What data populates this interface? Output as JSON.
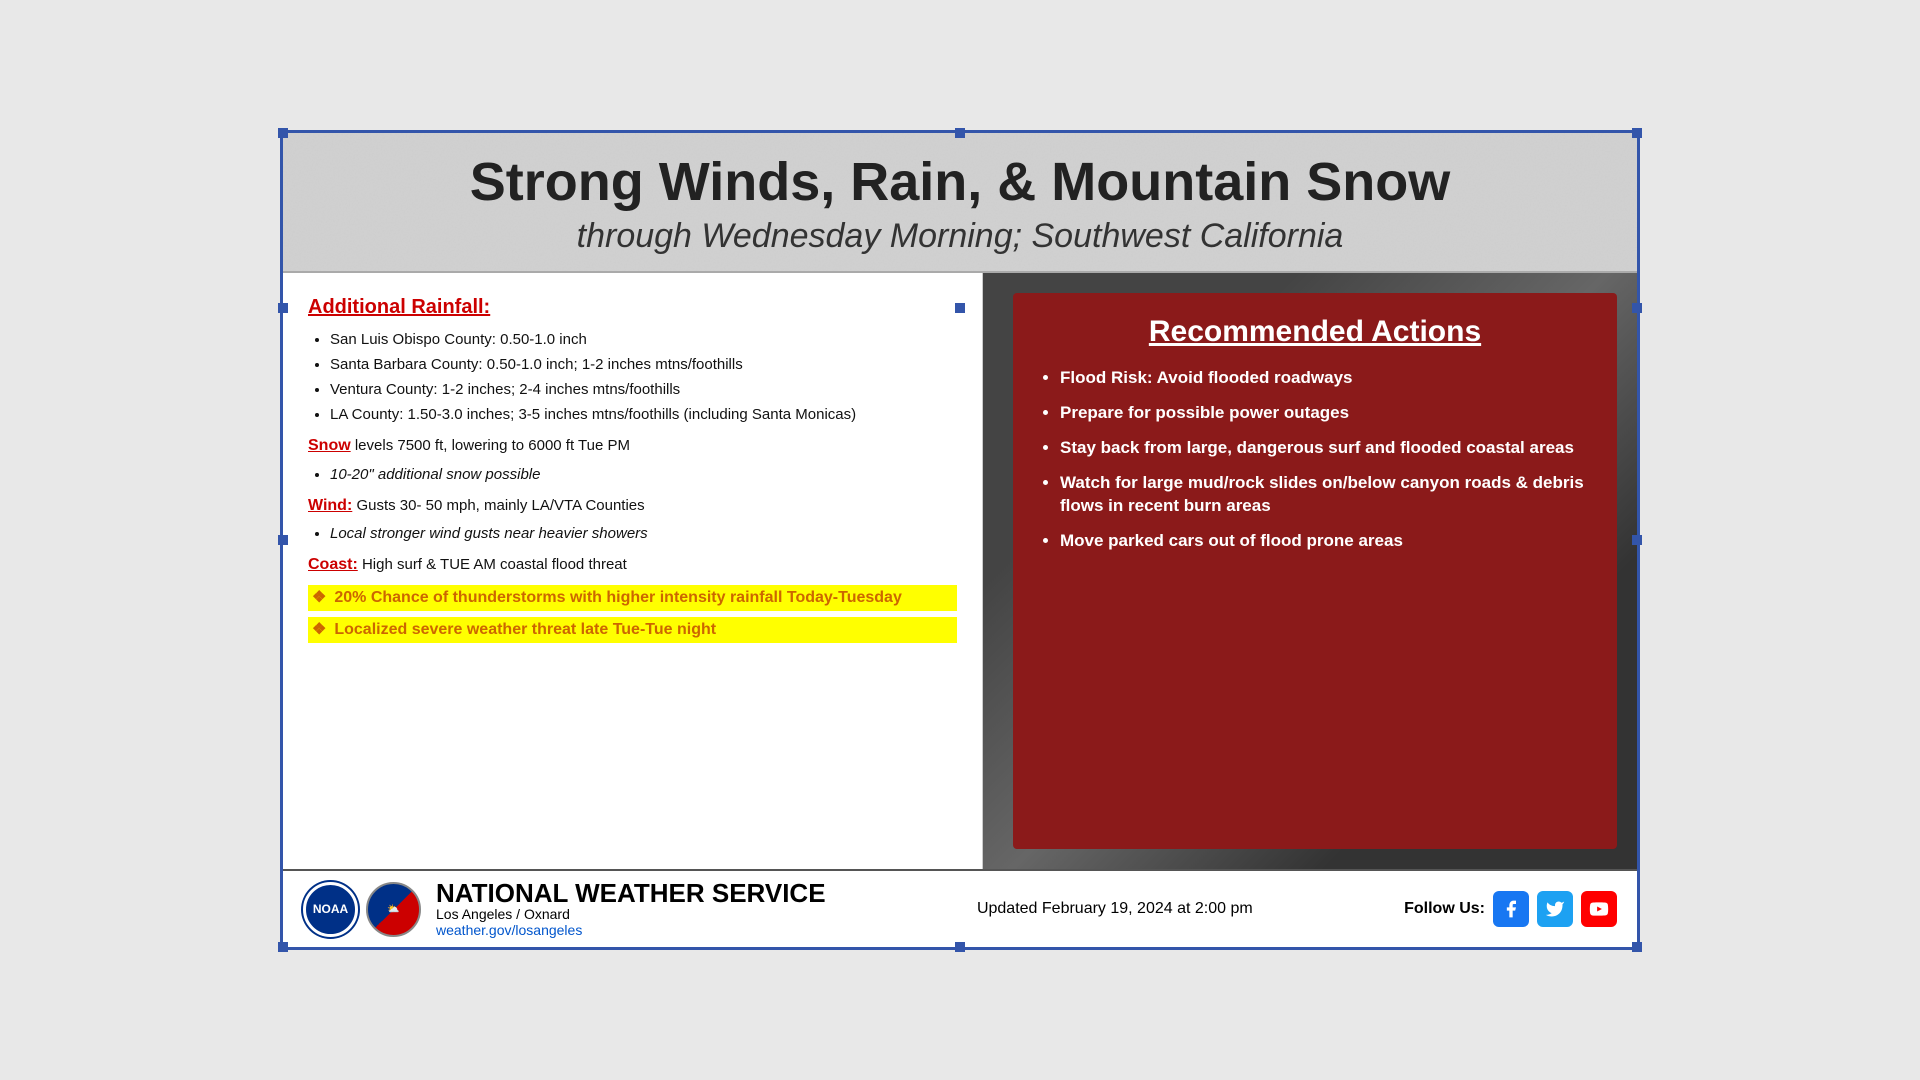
{
  "slide": {
    "header": {
      "main_title": "Strong Winds, Rain, & Mountain Snow",
      "sub_title": "through Wednesday Morning; Southwest California"
    },
    "left_panel": {
      "rainfall_title": "Additional Rainfall:",
      "rainfall_bullets": [
        "San Luis Obispo County: 0.50-1.0 inch",
        "Santa Barbara County: 0.50-1.0 inch; 1-2 inches mtns/foothills",
        "Ventura County: 1-2 inches; 2-4 inches mtns/foothills",
        "LA County: 1.50-3.0 inches; 3-5 inches mtns/foothills (including Santa Monicas)"
      ],
      "snow_line": "levels 7500 ft, lowering to 6000 ft Tue PM",
      "snow_label": "Snow",
      "snow_bullet": "10-20\" additional snow possible",
      "wind_label": "Wind:",
      "wind_text": "Gusts 30- 50 mph, mainly LA/VTA Counties",
      "wind_bullet": "Local stronger wind gusts near heavier showers",
      "coast_label": "Coast:",
      "coast_text": "High surf & TUE AM coastal flood threat",
      "highlight1": "20% Chance of thunderstorms with higher intensity rainfall Today-Tuesday",
      "highlight2": "Localized severe weather threat late Tue-Tue night"
    },
    "right_panel": {
      "title": "Recommended Actions",
      "bullets": [
        "Flood Risk: Avoid flooded roadways",
        "Prepare for possible power outages",
        "Stay back from large, dangerous surf and flooded coastal areas",
        "Watch for large mud/rock slides on/below canyon roads & debris flows in recent burn areas",
        "Move parked cars out of flood prone areas"
      ]
    },
    "footer": {
      "org_name": "NATIONAL WEATHER SERVICE",
      "org_sub": "Los Angeles / Oxnard",
      "org_url": "weather.gov/losangeles",
      "updated": "Updated February 19, 2024 at 2:00 pm",
      "follow_label": "Follow Us:",
      "noaa_label": "NOAA",
      "weather_label": "NWS"
    }
  }
}
